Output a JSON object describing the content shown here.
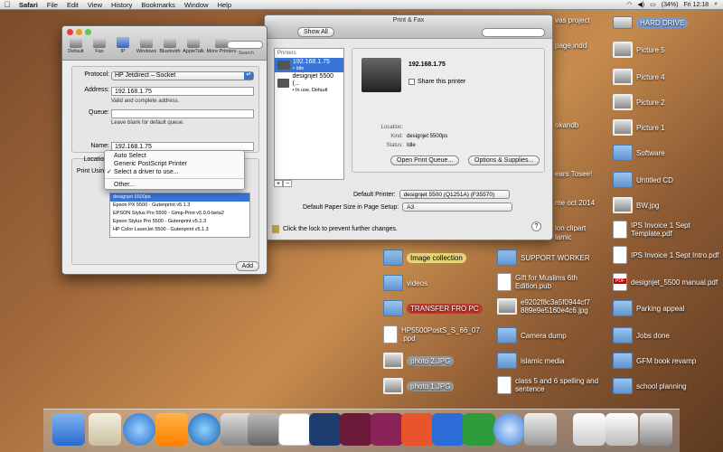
{
  "menubar": {
    "app": "Safari",
    "items": [
      "File",
      "Edit",
      "View",
      "History",
      "Bookmarks",
      "Window",
      "Help"
    ],
    "battery": "(34%)",
    "clock": "Fri 12:18"
  },
  "desktop_right": [
    {
      "label": "HARD DRIVE",
      "kind": "drive",
      "style": "hl2"
    },
    {
      "label": "Picture 5",
      "kind": "pic"
    },
    {
      "label": "Picture 4",
      "kind": "pic"
    },
    {
      "label": "Picture 2",
      "kind": "pic"
    },
    {
      "label": "Picture 1",
      "kind": "pic"
    },
    {
      "label": "Software",
      "kind": "folder"
    },
    {
      "label": "Untitled CD",
      "kind": "folder"
    },
    {
      "label": "BW.jpg",
      "kind": "pic"
    },
    {
      "label": "IPS Invoice 1 Sept Template.pdf",
      "kind": "doc"
    },
    {
      "label": "IPS Invoice 1 Sept Intro.pdf",
      "kind": "doc"
    },
    {
      "label": "designjet_5500 manual.pdf",
      "kind": "pdf"
    },
    {
      "label": "Parking appeal",
      "kind": "folder"
    },
    {
      "label": "Jobs done",
      "kind": "folder"
    },
    {
      "label": "GFM book revamp",
      "kind": "folder"
    },
    {
      "label": "school planning",
      "kind": "folder"
    }
  ],
  "desktop_behind": [
    "vas project",
    "page.indd",
    "okandb",
    "ears Tosee!",
    "me oct 2014",
    "ion clipart",
    "lamic"
  ],
  "desktop_mid": [
    {
      "label": "Image collection",
      "kind": "folder",
      "style": "hl"
    },
    {
      "label": "SUPPORT WORKER",
      "kind": "folder"
    },
    {
      "label": "videos",
      "kind": "folder"
    },
    {
      "label": "Gift for Muslims 6th Edition.pub",
      "kind": "doc"
    },
    {
      "label": "TRANSFER FRO PC",
      "kind": "folder",
      "style": "red"
    },
    {
      "label": "e9202f8c3a5f0944cf7 889e9e5160e4c6.jpg",
      "kind": "pic"
    },
    {
      "label": "HP5500PostS_S_66_07 .ppd",
      "kind": "doc"
    },
    {
      "label": "Camera dump",
      "kind": "folder"
    },
    {
      "label": "photo 2.JPG",
      "kind": "pic",
      "style": "gray"
    },
    {
      "label": "islamic media",
      "kind": "folder"
    },
    {
      "label": "photo 1.JPG",
      "kind": "pic",
      "style": "gray"
    },
    {
      "label": "class 5 and 6 spelling and sentence",
      "kind": "doc"
    }
  ],
  "printfax": {
    "title": "Print & Fax",
    "show_all": "Show All",
    "printers_header": "Printers",
    "printers": [
      {
        "name": "192.168.1.75",
        "status": "• Idle",
        "selected": true
      },
      {
        "name": "designjet 5500 (...",
        "status": "• In use, Default",
        "selected": false
      }
    ],
    "detail_name": "192.168.1.75",
    "share_label": "Share this printer",
    "location_label": "Location:",
    "location_value": "",
    "kind_label": "Kind:",
    "kind_value": "designjet 5500ps",
    "status_label": "Status:",
    "status_value": "Idle",
    "open_queue": "Open Print Queue...",
    "options": "Options & Supplies...",
    "default_printer_label": "Default Printer:",
    "default_printer_value": "designjet 5500 (Q1251A) (F35570)",
    "paper_size_label": "Default Paper Size in Page Setup:",
    "paper_size_value": "A3",
    "lock_text": "Click the lock to prevent further changes.",
    "help": "?"
  },
  "addprinter": {
    "tools": [
      "Default",
      "Fax",
      "IP",
      "Windows",
      "Bluetooth",
      "AppleTalk",
      "More Printers"
    ],
    "search_label": "Search",
    "protocol_label": "Protocol:",
    "protocol_value": "HP Jetdirect – Socket",
    "address_label": "Address:",
    "address_value": "192.168.1.75",
    "address_hint": "Valid and complete address.",
    "queue_label": "Queue:",
    "queue_value": "",
    "queue_hint": "Leave blank for default queue.",
    "name_label": "Name:",
    "name_value": "192.168.1.75",
    "location_label": "Location:",
    "print_using_label": "Print Using:",
    "drivers": [
      "designjet 5500ps",
      "Epson PX 5500 - Gutenprint v5.1.3",
      "EPSON Stylus Pro 5500 - Gimp-Print v5.0.0-beta2",
      "Epson Stylus Pro 5500 - Gutenprint v5.1.3",
      "HP Color LaserJet 5500 - Gutenprint v5.1.3"
    ],
    "add_button": "Add"
  },
  "menu": {
    "items": [
      "Auto Select",
      "Generic PostScript Printer",
      "Select a driver to use...",
      "Other..."
    ],
    "checked_index": 2
  }
}
